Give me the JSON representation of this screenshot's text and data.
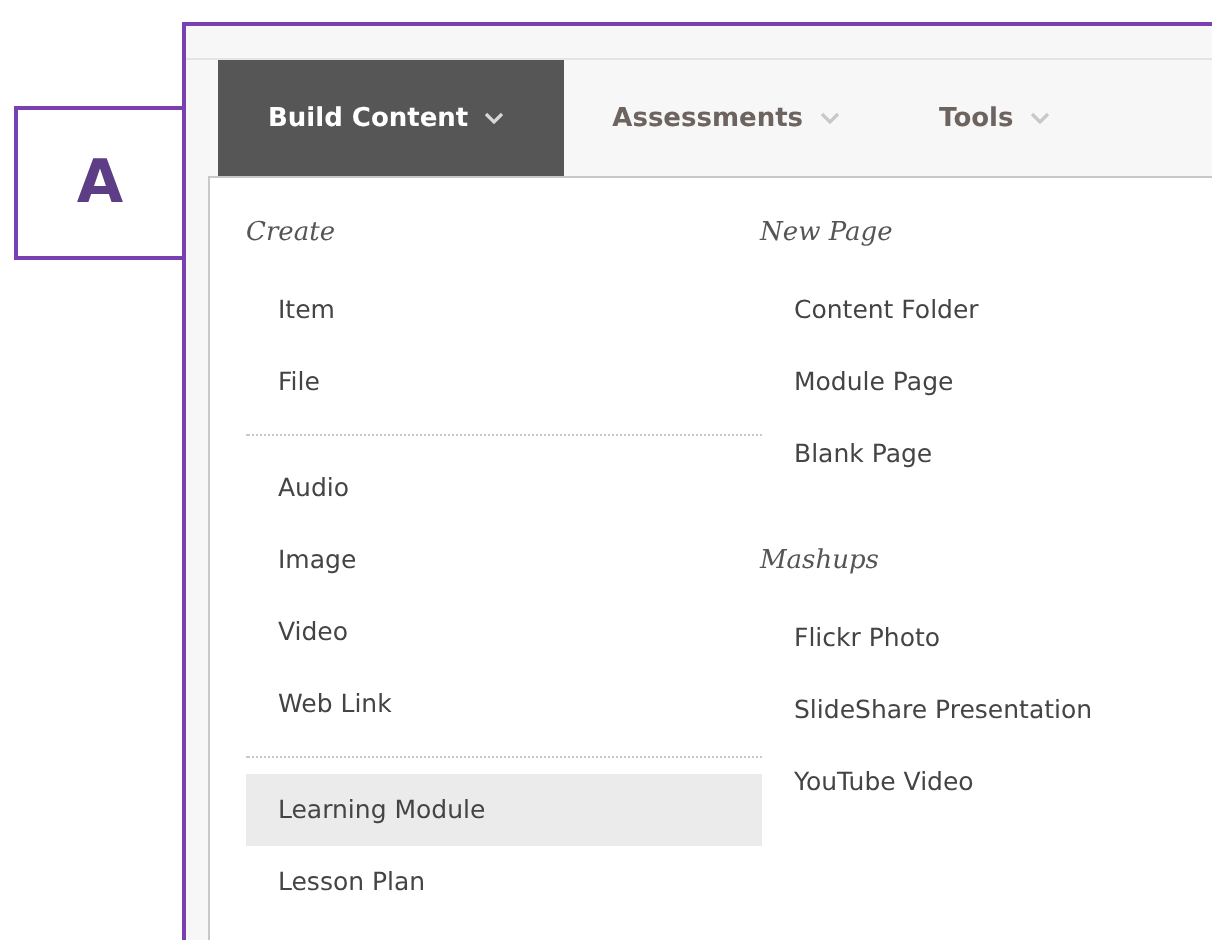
{
  "callout": {
    "label": "A"
  },
  "tabs": [
    {
      "label": "Build Content",
      "selected": true
    },
    {
      "label": "Assessments",
      "selected": false
    },
    {
      "label": "Tools",
      "selected": false
    }
  ],
  "menu": {
    "columns": [
      {
        "groups": [
          {
            "header": "Create",
            "sections": [
              [
                {
                  "label": "Item",
                  "selected": false
                },
                {
                  "label": "File",
                  "selected": false
                }
              ],
              [
                {
                  "label": "Audio",
                  "selected": false
                },
                {
                  "label": "Image",
                  "selected": false
                },
                {
                  "label": "Video",
                  "selected": false
                },
                {
                  "label": "Web Link",
                  "selected": false
                }
              ],
              [
                {
                  "label": "Learning Module",
                  "selected": true
                },
                {
                  "label": "Lesson Plan",
                  "selected": false
                }
              ]
            ]
          }
        ]
      },
      {
        "groups": [
          {
            "header": "New Page",
            "sections": [
              [
                {
                  "label": "Content Folder",
                  "selected": false
                },
                {
                  "label": "Module Page",
                  "selected": false
                },
                {
                  "label": "Blank Page",
                  "selected": false
                }
              ]
            ]
          },
          {
            "header": "Mashups",
            "sections": [
              [
                {
                  "label": "Flickr Photo",
                  "selected": false
                },
                {
                  "label": "SlideShare Presentation",
                  "selected": false
                },
                {
                  "label": "YouTube Video",
                  "selected": false
                }
              ]
            ]
          }
        ]
      }
    ]
  }
}
